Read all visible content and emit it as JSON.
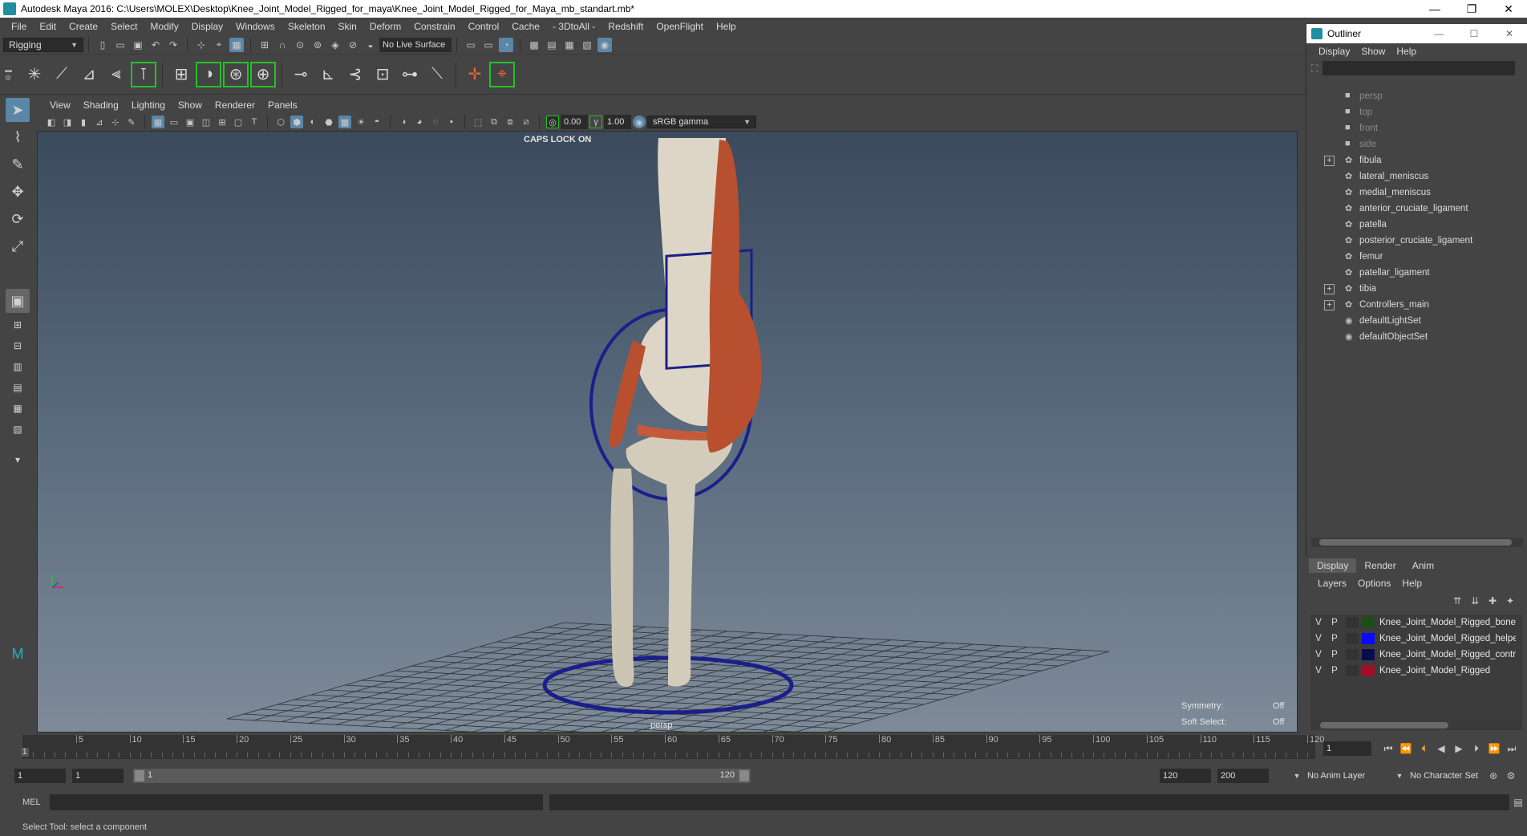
{
  "window": {
    "title": "Autodesk Maya 2016: C:\\Users\\MOLEX\\Desktop\\Knee_Joint_Model_Rigged_for_maya\\Knee_Joint_Model_Rigged_for_Maya_mb_standart.mb*",
    "minimize": "—",
    "restore": "❐",
    "close": "✕"
  },
  "menubar": [
    "File",
    "Edit",
    "Create",
    "Select",
    "Modify",
    "Display",
    "Windows",
    "Skeleton",
    "Skin",
    "Deform",
    "Constrain",
    "Control",
    "Cache",
    "- 3DtoAll -",
    "Redshift",
    "OpenFlight",
    "Help"
  ],
  "statusline": {
    "menuset": "Rigging",
    "live_surface": "No Live Surface"
  },
  "panel": {
    "menus": [
      "View",
      "Shading",
      "Lighting",
      "Show",
      "Renderer",
      "Panels"
    ],
    "exposure": "0.00",
    "gamma": "1.00",
    "colorspace": "sRGB gamma"
  },
  "viewport": {
    "caps_lock": "CAPS LOCK ON",
    "camera": "persp",
    "symmetry_label": "Symmetry:",
    "symmetry_value": "Off",
    "soft_select_label": "Soft Select:",
    "soft_select_value": "Off",
    "colors": {
      "bone": "#d9d2c1",
      "muscle": "#b8502f",
      "controller": "#1a1f8a"
    }
  },
  "timeline": {
    "ticks": [
      5,
      10,
      15,
      20,
      25,
      30,
      35,
      40,
      45,
      50,
      55,
      60,
      65,
      70,
      75,
      80,
      85,
      90,
      95,
      100,
      105,
      110,
      115,
      120
    ],
    "start_marker": "1",
    "current_frame": "1"
  },
  "range": {
    "start": "1",
    "playback_start": "1",
    "slider_start": "1",
    "slider_end": "120",
    "playback_end": "120",
    "end": "200",
    "anim_layer": "No Anim Layer",
    "character_set": "No Character Set"
  },
  "cmdline": {
    "label": "MEL"
  },
  "helpline": {
    "text": "Select Tool: select a component"
  },
  "outliner": {
    "title": "Outliner",
    "menus": [
      "Display",
      "Show",
      "Help"
    ],
    "items": [
      {
        "name": "persp",
        "dim": true,
        "expand": false,
        "icon": "camera-icon"
      },
      {
        "name": "top",
        "dim": true,
        "expand": false,
        "icon": "camera-icon"
      },
      {
        "name": "front",
        "dim": true,
        "expand": false,
        "icon": "camera-icon"
      },
      {
        "name": "side",
        "dim": true,
        "expand": false,
        "icon": "camera-icon"
      },
      {
        "name": "fibula",
        "dim": false,
        "expand": true,
        "icon": "transform-icon"
      },
      {
        "name": "lateral_meniscus",
        "dim": false,
        "expand": false,
        "icon": "transform-icon"
      },
      {
        "name": "medial_meniscus",
        "dim": false,
        "expand": false,
        "icon": "transform-icon"
      },
      {
        "name": "anterior_cruciate_ligament",
        "dim": false,
        "expand": false,
        "icon": "transform-icon"
      },
      {
        "name": "patella",
        "dim": false,
        "expand": false,
        "icon": "transform-icon"
      },
      {
        "name": "posterior_cruciate_ligament",
        "dim": false,
        "expand": false,
        "icon": "transform-icon"
      },
      {
        "name": "femur",
        "dim": false,
        "expand": false,
        "icon": "transform-icon"
      },
      {
        "name": "patellar_ligament",
        "dim": false,
        "expand": false,
        "icon": "transform-icon"
      },
      {
        "name": "tibia",
        "dim": false,
        "expand": true,
        "icon": "transform-icon"
      },
      {
        "name": "Controllers_main",
        "dim": false,
        "expand": true,
        "icon": "transform-icon"
      },
      {
        "name": "defaultLightSet",
        "dim": false,
        "expand": false,
        "icon": "set-icon"
      },
      {
        "name": "defaultObjectSet",
        "dim": false,
        "expand": false,
        "icon": "set-icon"
      }
    ]
  },
  "layers": {
    "tabs": [
      "Display",
      "Render",
      "Anim"
    ],
    "menus": [
      "Layers",
      "Options",
      "Help"
    ],
    "rows": [
      {
        "v": "V",
        "p": "P",
        "color": "#1a4d1a",
        "name": "Knee_Joint_Model_Rigged_bones"
      },
      {
        "v": "V",
        "p": "P",
        "color": "#0a0aff",
        "name": "Knee_Joint_Model_Rigged_helpers"
      },
      {
        "v": "V",
        "p": "P",
        "color": "#0a0a50",
        "name": "Knee_Joint_Model_Rigged_controllers"
      },
      {
        "v": "V",
        "p": "P",
        "color": "#a0102a",
        "name": "Knee_Joint_Model_Rigged"
      }
    ]
  }
}
